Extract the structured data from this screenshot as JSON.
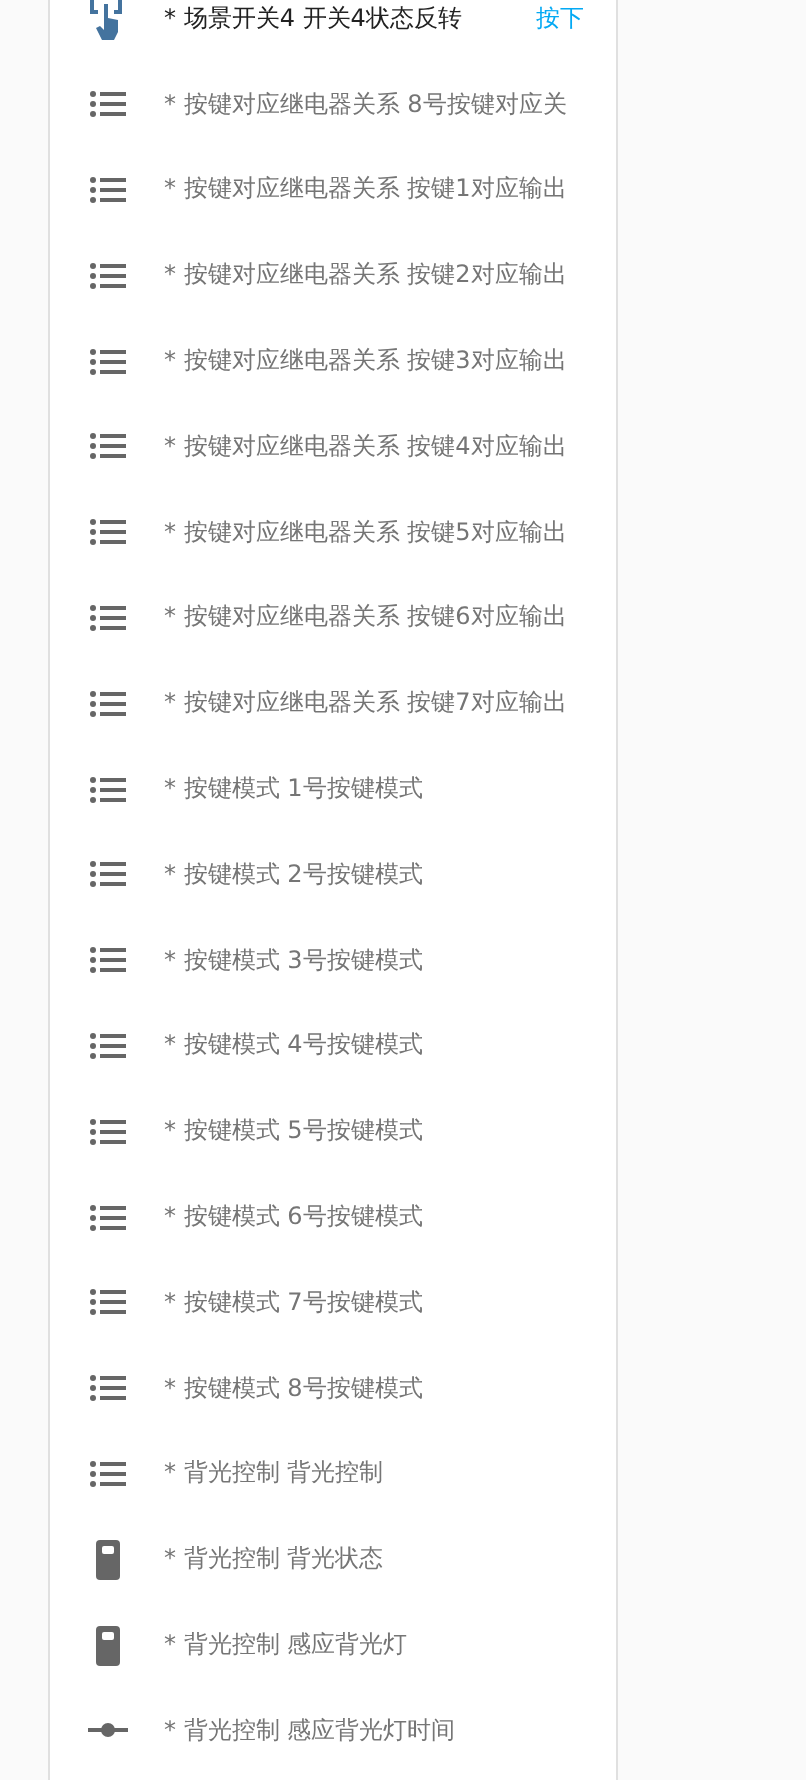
{
  "entities": [
    {
      "kind": "button",
      "name": "* 场景开关4 开关4状态反转",
      "action": "按下"
    },
    {
      "kind": "select",
      "name": "* 按键对应继电器关系 8号按键对应关"
    },
    {
      "kind": "select",
      "name": "* 按键对应继电器关系 按键1对应输出"
    },
    {
      "kind": "select",
      "name": "* 按键对应继电器关系 按键2对应输出"
    },
    {
      "kind": "select",
      "name": "* 按键对应继电器关系 按键3对应输出"
    },
    {
      "kind": "select",
      "name": "* 按键对应继电器关系 按键4对应输出"
    },
    {
      "kind": "select",
      "name": "* 按键对应继电器关系 按键5对应输出"
    },
    {
      "kind": "select",
      "name": "* 按键对应继电器关系 按键6对应输出"
    },
    {
      "kind": "select",
      "name": "* 按键对应继电器关系 按键7对应输出"
    },
    {
      "kind": "select",
      "name": "* 按键模式 1号按键模式"
    },
    {
      "kind": "select",
      "name": "* 按键模式 2号按键模式"
    },
    {
      "kind": "select",
      "name": "* 按键模式 3号按键模式"
    },
    {
      "kind": "select",
      "name": "* 按键模式 4号按键模式"
    },
    {
      "kind": "select",
      "name": "* 按键模式 5号按键模式"
    },
    {
      "kind": "select",
      "name": "* 按键模式 6号按键模式"
    },
    {
      "kind": "select",
      "name": "* 按键模式 7号按键模式"
    },
    {
      "kind": "select",
      "name": "* 按键模式 8号按键模式"
    },
    {
      "kind": "select",
      "name": "* 背光控制 背光控制"
    },
    {
      "kind": "binary",
      "name": "* 背光控制 背光状态"
    },
    {
      "kind": "binary",
      "name": "* 背光控制 感应背光灯"
    },
    {
      "kind": "number",
      "name": "* 背光控制 感应背光灯时间"
    }
  ]
}
